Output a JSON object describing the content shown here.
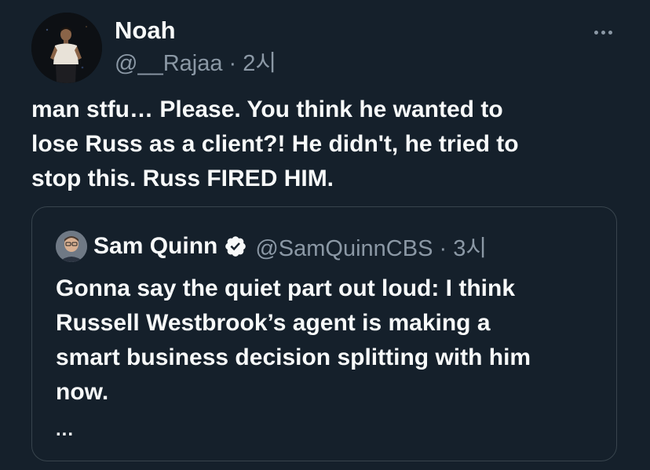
{
  "tweet": {
    "author": {
      "display_name": "Noah",
      "handle_time": "@__Rajaa · 2시"
    },
    "more_icon": "more-horizontal-icon",
    "text_lines": [
      "man stfu… Please. You think he wanted to",
      "lose Russ as a client?! He didn't, he tried to",
      "stop this. Russ FIRED HIM."
    ]
  },
  "quote": {
    "author": {
      "display_name": "Sam Quinn",
      "verified_icon": "verified-badge-icon",
      "handle_time": "@SamQuinnCBS · 3시"
    },
    "text_lines": [
      "Gonna say the quiet part out loud: I think",
      "Russell Westbrook’s agent is making a",
      "smart business decision splitting with him",
      "now."
    ],
    "truncation": "..."
  },
  "colors": {
    "background": "#15202b",
    "text_primary": "#f7f9f9",
    "text_secondary": "#8b98a5",
    "border": "#38444d",
    "verified_badge": "#f7f9f9"
  }
}
